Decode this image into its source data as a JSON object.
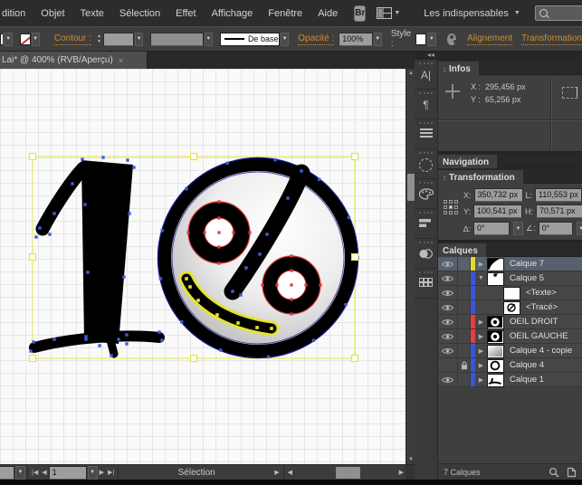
{
  "menu_bar": {
    "items": [
      "dition",
      "Objet",
      "Texte",
      "Sélection",
      "Effet",
      "Affichage",
      "Fenêtre",
      "Aide"
    ],
    "bridge_label": "Br",
    "workspace_label": "Les indispensables",
    "search_value": ""
  },
  "control_bar": {
    "contour_label": "Contour :",
    "brush_label": "De base",
    "opacity_label": "Opacité :",
    "opacity_value": "100%",
    "style_label": "Style :",
    "align_link": "Alignement",
    "transform_link": "Transformation",
    "accent_color": "#cf8a33"
  },
  "document_tab": {
    "title": "Lai* @ 400% (RVB/Aperçu)",
    "close_label": "×"
  },
  "dock": {
    "collapse_glyph": "◂◂",
    "icon_names": [
      "character",
      "paragraph",
      "paragraph-styles",
      "stroke-circle",
      "color",
      "align",
      "transparency",
      "swatches"
    ]
  },
  "infos_panel": {
    "tab_label": "Infos",
    "x_label": "X :",
    "x_value": "295,456 px",
    "y_label": "Y :",
    "y_value": "65,256 px"
  },
  "navigation_panel": {
    "tab_label": "Navigation"
  },
  "transformation_panel": {
    "tab_label": "Transformation",
    "x_label": "X:",
    "x_value": "350,732 px",
    "y_label": "Y:",
    "y_value": "100,541 px",
    "l_label": "L:",
    "l_value": "110,553 px",
    "h_label": "H:",
    "h_value": "70,571 px",
    "angle_label": "∆:",
    "angle_value": "0°",
    "shear_label": "∠:",
    "shear_value": "0°"
  },
  "layers_panel": {
    "tab_label": "Calques",
    "status_label": "7 Calques",
    "rows": [
      {
        "name": "Calque 7",
        "color": "#e6d92a",
        "eye": true,
        "lock": false,
        "expand": "right",
        "indent": 0,
        "thumb": "curve",
        "selected": true
      },
      {
        "name": "Calque 5",
        "color": "#3a56d4",
        "eye": true,
        "lock": false,
        "expand": "down",
        "indent": 0,
        "thumb": "percent",
        "selected": false
      },
      {
        "name": "<Texte>",
        "color": "#3a56d4",
        "eye": true,
        "lock": false,
        "expand": null,
        "indent": 1,
        "thumb": "blank",
        "selected": false
      },
      {
        "name": "<Tracé>",
        "color": "#3a56d4",
        "eye": true,
        "lock": false,
        "expand": null,
        "indent": 1,
        "thumb": "traced",
        "selected": false
      },
      {
        "name": "OEIL DROIT",
        "color": "#e04040",
        "eye": true,
        "lock": false,
        "expand": "right",
        "indent": 0,
        "thumb": "eyering",
        "selected": false
      },
      {
        "name": "OEIL GAUCHE",
        "color": "#e04040",
        "eye": true,
        "lock": false,
        "expand": "right",
        "indent": 0,
        "thumb": "eyering",
        "selected": false
      },
      {
        "name": "Calque 4 - copie",
        "color": "#3a56d4",
        "eye": true,
        "lock": false,
        "expand": "right",
        "indent": 0,
        "thumb": "gradient",
        "selected": false
      },
      {
        "name": "Calque 4",
        "color": "#3a56d4",
        "eye": false,
        "lock": true,
        "expand": "right",
        "indent": 0,
        "thumb": "circle",
        "selected": false
      },
      {
        "name": "Calque 1",
        "color": "#3a56d4",
        "eye": true,
        "lock": false,
        "expand": "right",
        "indent": 0,
        "thumb": "marks",
        "selected": false
      }
    ]
  },
  "status_bar": {
    "artboard_value": "1",
    "mode_label": "Sélection"
  },
  "artwork": {
    "selection_color": "#e5e545",
    "anchor_blue": "#3a5fd9",
    "anchor_red": "#d93a3a",
    "anchor_yellow": "#e5e530",
    "path_outline_navy": "#16168e"
  }
}
